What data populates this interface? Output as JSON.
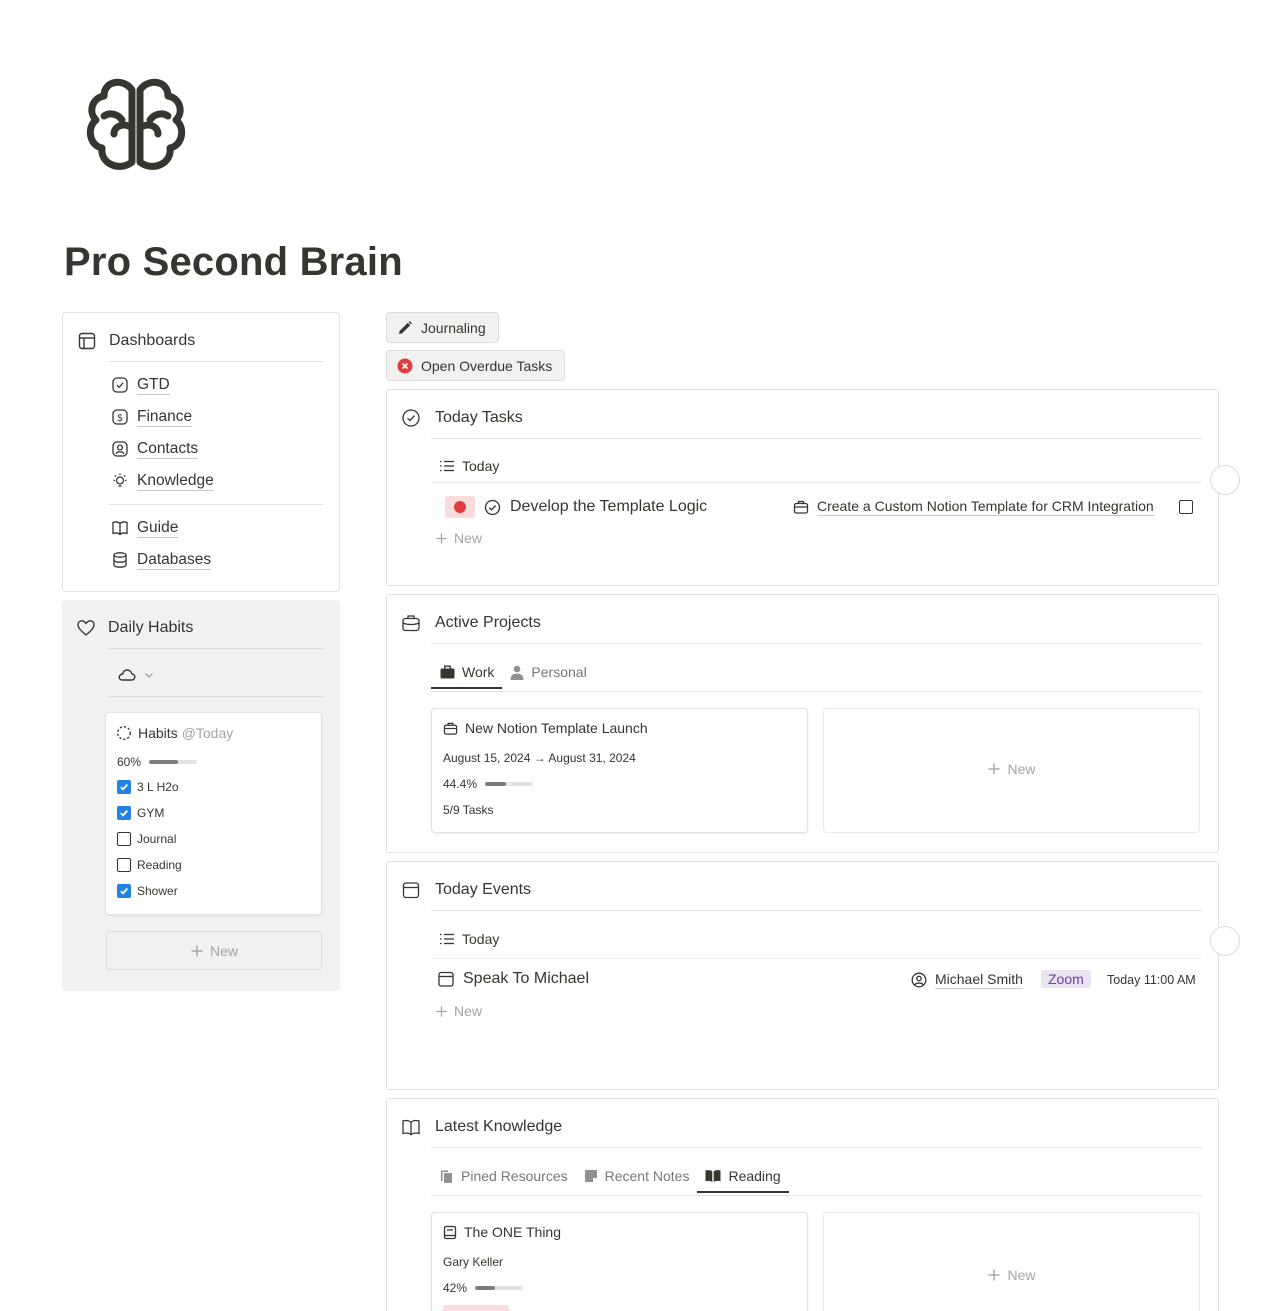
{
  "page": {
    "title": "Pro Second Brain",
    "icon": "brain-icon"
  },
  "dashboards": {
    "header": "Dashboards",
    "items": [
      {
        "label": "GTD",
        "icon": "check-circle-icon"
      },
      {
        "label": "Finance",
        "icon": "dollar-icon"
      },
      {
        "label": "Contacts",
        "icon": "contact-icon"
      },
      {
        "label": "Knowledge",
        "icon": "lightbulb-icon"
      }
    ],
    "extra": [
      {
        "label": "Guide",
        "icon": "book-icon"
      },
      {
        "label": "Databases",
        "icon": "database-icon"
      }
    ]
  },
  "habits": {
    "header": "Daily Habits",
    "weather_icon": "cloud-icon",
    "card_title": "Habits",
    "card_date": "@Today",
    "progress_label": "60%",
    "progress": 0.6,
    "items": [
      {
        "label": "3 L H2o",
        "checked": true
      },
      {
        "label": "GYM",
        "checked": true
      },
      {
        "label": "Journal",
        "checked": false
      },
      {
        "label": "Reading",
        "checked": false
      },
      {
        "label": "Shower",
        "checked": true
      }
    ],
    "new_label": "New"
  },
  "buttons": {
    "journaling": "Journaling",
    "overdue": "Open Overdue Tasks"
  },
  "today_tasks": {
    "header": "Today Tasks",
    "view": "Today",
    "task": {
      "title": "Develop the Template Logic",
      "project": "Create a Custom Notion Template for CRM Integration"
    },
    "new_label": "New"
  },
  "active_projects": {
    "header": "Active Projects",
    "tabs": [
      "Work",
      "Personal"
    ],
    "project": {
      "title": "New Notion Template Launch",
      "dates": "August 15, 2024 → August 31, 2024",
      "progress_label": "44.4%",
      "progress": 0.444,
      "tasks": "5/9 Tasks"
    },
    "new_label": "New"
  },
  "today_events": {
    "header": "Today Events",
    "view": "Today",
    "event": {
      "title": "Speak To Michael",
      "person": "Michael Smith",
      "tag": "Zoom",
      "time": "Today 11:00 AM"
    },
    "new_label": "New"
  },
  "latest_knowledge": {
    "header": "Latest Knowledge",
    "tabs": [
      "Pined Resources",
      "Recent Notes",
      "Reading"
    ],
    "book": {
      "title": "The ONE Thing",
      "author": "Gary Keller",
      "progress_label": "42%",
      "progress": 0.42
    },
    "new_label": "New"
  }
}
